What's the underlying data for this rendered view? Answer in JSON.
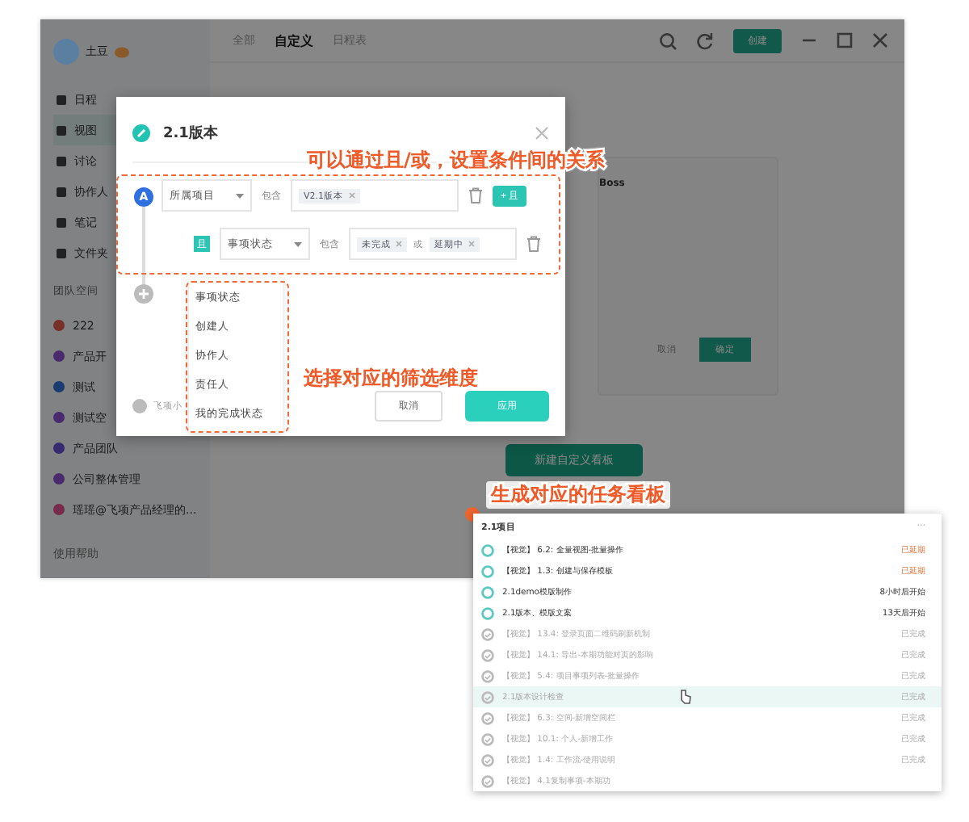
{
  "user": {
    "name": "土豆"
  },
  "sidebar": {
    "items": [
      {
        "label": "日程",
        "selected": false
      },
      {
        "label": "视图",
        "selected": true
      },
      {
        "label": "讨论",
        "selected": false
      },
      {
        "label": "协作人",
        "selected": false
      },
      {
        "label": "笔记",
        "selected": false
      },
      {
        "label": "文件夹",
        "selected": false
      }
    ],
    "team_header": "团队空间",
    "spaces": [
      {
        "label": "222",
        "color": "#773027"
      },
      {
        "label": "产品开",
        "color": "#492a6e"
      },
      {
        "label": "测试",
        "color": "#193b71"
      },
      {
        "label": "测试空",
        "color": "#492a6e"
      },
      {
        "label": "产品团队",
        "color": "#382a6e"
      },
      {
        "label": "公司整体管理",
        "color": "#492a6e"
      },
      {
        "label": "瑶瑶@飞项产品经理的...",
        "color": "#772a49"
      }
    ],
    "help": "使用帮助"
  },
  "tabs": [
    {
      "label": "全部",
      "selected": false
    },
    {
      "label": "自定义",
      "selected": true
    },
    {
      "label": "日程表",
      "selected": false
    }
  ],
  "create_button": "创建",
  "back_card": {
    "title_tail": "Boss",
    "cancel": "取消",
    "ok": "确定"
  },
  "new_board_button": "新建自定义看板",
  "dialog": {
    "title": "2.1版本",
    "logic": "A",
    "conditions": [
      {
        "field": "所属项目",
        "op": "包含",
        "tags": [
          "V2.1版本"
        ],
        "add": "+ 且"
      },
      {
        "badge": "且",
        "field": "事项状态",
        "op": "包含",
        "tags": [
          "未完成",
          "延期中"
        ],
        "joiners": [
          "或"
        ]
      }
    ],
    "dropdown": [
      "事项状态",
      "创建人",
      "协作人",
      "责任人",
      "我的完成状态"
    ],
    "tip": "飞项小",
    "cancel": "取消",
    "apply": "应用"
  },
  "annotations": [
    "可以通过且/或，设置条件间的关系",
    "选择对应的筛选维度",
    "生成对应的任务看板"
  ],
  "board": {
    "title": "2.1项目",
    "more": "···",
    "rows": [
      {
        "text": "【视觉】 6.2: 全量视图-批量操作",
        "status": "已延期",
        "kind": "overdue",
        "highlighted": false
      },
      {
        "text": "【视觉】 1.3: 创建与保存模板",
        "status": "已延期",
        "kind": "overdue",
        "highlighted": false
      },
      {
        "text": "2.1demo模版制作",
        "status": "8小时后开始",
        "kind": "upcoming",
        "highlighted": false
      },
      {
        "text": "2.1版本、模版文案",
        "status": "13天后开始",
        "kind": "upcoming",
        "highlighted": false
      },
      {
        "text": "【视觉】 13.4: 登录页面二维码刷新机制",
        "status": "已完成",
        "kind": "done",
        "highlighted": false
      },
      {
        "text": "【视觉】 14.1: 导出-本期功能对页的影响",
        "status": "已完成",
        "kind": "done",
        "highlighted": false
      },
      {
        "text": "【视觉】 5.4: 项目事项列表-批量操作",
        "status": "已完成",
        "kind": "done",
        "highlighted": false
      },
      {
        "text": "2.1版本设计检查",
        "status": "已完成",
        "kind": "done",
        "highlighted": true
      },
      {
        "text": "【视觉】 6.3: 空间-新增空间栏",
        "status": "已完成",
        "kind": "done",
        "highlighted": false
      },
      {
        "text": "【视觉】 10.1: 个人-新增工作",
        "status": "已完成",
        "kind": "done",
        "highlighted": false
      },
      {
        "text": "【视觉】 1.4: 工作流-使用说明",
        "status": "已完成",
        "kind": "done",
        "highlighted": false
      },
      {
        "text": "【视觉】 4.1复制事项-本期功",
        "kind": "done",
        "highlighted": false
      }
    ]
  }
}
